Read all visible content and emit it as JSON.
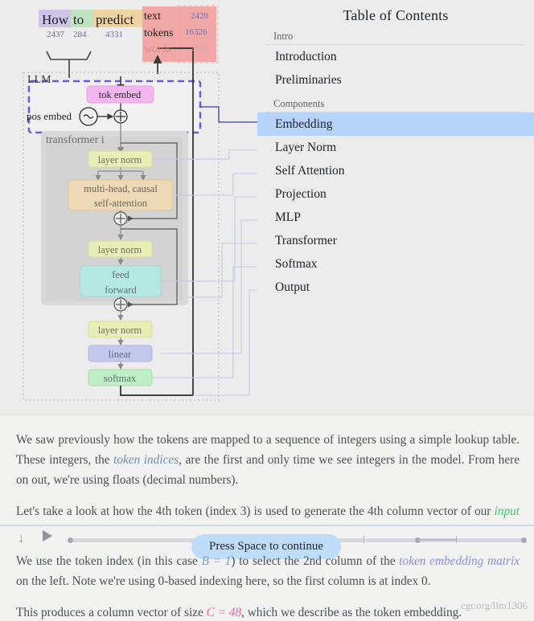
{
  "toc": {
    "title": "Table of Contents",
    "groups": [
      {
        "label": "Intro",
        "items": [
          {
            "label": "Introduction",
            "active": false
          },
          {
            "label": "Preliminaries",
            "active": false
          }
        ]
      },
      {
        "label": "Components",
        "items": [
          {
            "label": "Embedding",
            "active": true
          },
          {
            "label": "Layer Norm",
            "active": false
          },
          {
            "label": "Self Attention",
            "active": false
          },
          {
            "label": "Projection",
            "active": false
          },
          {
            "label": "MLP",
            "active": false
          },
          {
            "label": "Transformer",
            "active": false
          },
          {
            "label": "Softmax",
            "active": false
          },
          {
            "label": "Output",
            "active": false
          }
        ]
      }
    ],
    "active_highlight_color": "#b6d4fb"
  },
  "diagram": {
    "prompt_tokens": [
      {
        "word": "How",
        "id": "2437",
        "color": "#cfc3ea"
      },
      {
        "word": "to",
        "id": "284",
        "color": "#bfe5c0"
      },
      {
        "word": "predict",
        "id": "4331",
        "color": "#f0d3a0"
      }
    ],
    "vocab_panel": {
      "rows": [
        {
          "label": "text",
          "value": "2420",
          "dim": false
        },
        {
          "label": "tokens",
          "value": "16326",
          "dim": false
        },
        {
          "label": "words",
          "value": "2456",
          "dim": true
        }
      ],
      "fill": "#f2a7a7",
      "border": "#f0b2b2"
    },
    "llm_label": "LLM",
    "transformer_label": "transformer i",
    "blocks": [
      {
        "name": "tok embed",
        "fill": "#f3b6f0",
        "border": "#e89fe4",
        "text": "#2a2a2a"
      },
      {
        "name": "pos embed",
        "fill": "none"
      },
      {
        "name": "layer norm",
        "fill": "#e9eeb6",
        "border": "#d9df9f",
        "text": "#6b6f63"
      },
      {
        "name": "multi-head, causal self-attention",
        "fill": "#eed9b6",
        "border": "#e0c79c",
        "text": "#6b6558"
      },
      {
        "name": "feed forward",
        "fill": "#b6e8e3",
        "border": "#9fd8d2",
        "text": "#5d6f6e"
      },
      {
        "name": "linear",
        "fill": "#c3c9ee",
        "border": "#adb5e0",
        "text": "#5f6477"
      },
      {
        "name": "softmax",
        "fill": "#bdeec4",
        "border": "#a4dfad",
        "text": "#5f7464"
      }
    ],
    "highlight_border_color": "#6a5fd0"
  },
  "prose": {
    "p1": {
      "a": "We saw previously how the tokens are mapped to a sequence of integers using a simple lookup table. These integers, the ",
      "link": "token indices",
      "b": ", are the first and only time we see integers in the model. From here on out, we're using floats (decimal numbers)."
    },
    "p2": {
      "a": "Let's take a look at how the 4th token (index 3) is used to generate the 4th column vector of our ",
      "link": "input embedding",
      "b": "."
    },
    "p3": {
      "a": "We use the token index (in this case ",
      "var": "B = 1",
      "b": ") to select the 2nd column of the ",
      "link": "token embedding matrix",
      "c": " on the left. Note we're using 0-based indexing here, so the first column is at index 0."
    },
    "p4": {
      "a": "This produces a column vector of size ",
      "var": "C = 48",
      "b": ", which we describe as the token embedding."
    }
  },
  "player": {
    "down_icon": "down-arrow-icon",
    "play_icon": "play-icon",
    "tooltip": "Press Space to continue"
  },
  "watermark": "cgr.org/llm1306"
}
